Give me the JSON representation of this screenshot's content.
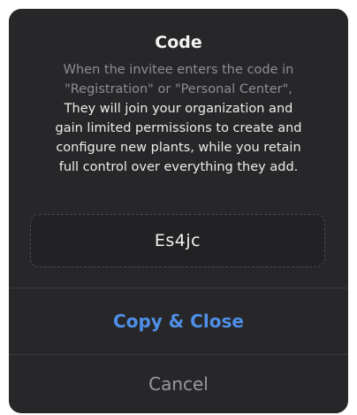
{
  "dialog": {
    "title": "Code",
    "description_lines_muted": [
      "When the invitee enters the code in",
      "\"Registration\" or \"Personal Center\","
    ],
    "description_lines": [
      "They will join your organization and",
      "gain limited permissions to create and",
      "configure new plants, while you retain",
      "full control over everything they add."
    ],
    "code": "Es4jc",
    "copy_label": "Copy & Close",
    "cancel_label": "Cancel"
  },
  "colors": {
    "dialog_bg": "#272729",
    "accent": "#4f8fe8",
    "muted_text": "#8e8e93",
    "primary_text": "#f2f2f2"
  }
}
